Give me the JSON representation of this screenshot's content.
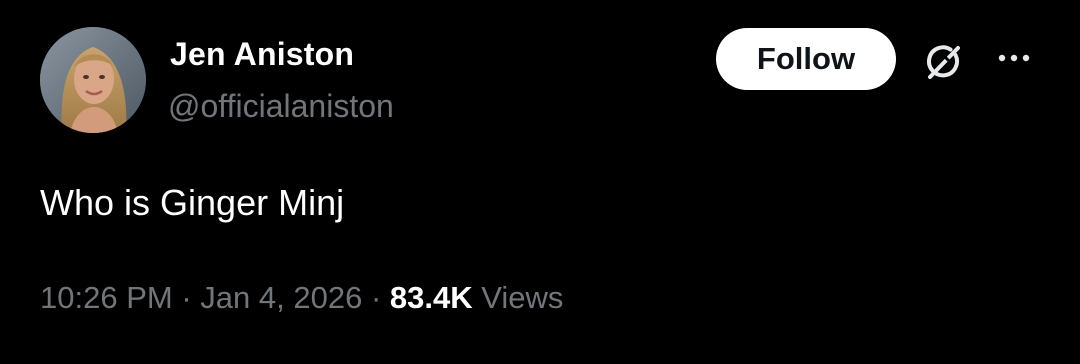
{
  "author": {
    "display_name": "Jen Aniston",
    "handle": "@officialaniston",
    "avatar_icon": "profile-photo"
  },
  "actions": {
    "follow_label": "Follow",
    "grok_icon": "grok-icon",
    "more_icon": "more-options-icon"
  },
  "tweet": {
    "text": "Who is Ginger Minj"
  },
  "meta": {
    "time": "10:26 PM",
    "separator_1": "·",
    "date": "Jan 4, 2026",
    "separator_2": "·",
    "views_count": "83.4K",
    "views_label": "Views"
  },
  "colors": {
    "background": "#000000",
    "primary_text": "#ffffff",
    "secondary_text": "#71767b",
    "follow_bg": "#ffffff",
    "follow_text": "#0f1419"
  }
}
